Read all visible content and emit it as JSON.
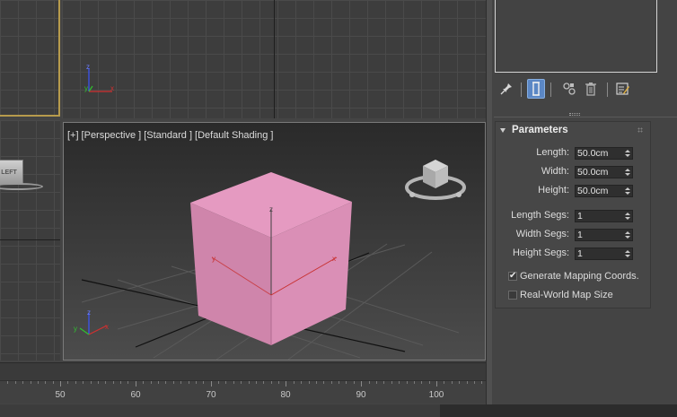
{
  "viewports": {
    "top_axis_labels": {
      "y": "y",
      "z": "z",
      "x": "x"
    },
    "left_cube_label": "LEFT",
    "perspective": {
      "label_items": [
        "[+]",
        "[Perspective ]",
        "[Standard ]",
        "[Default Shading ]"
      ],
      "gizmo_axis_labels": {
        "z": "z",
        "y": "y",
        "x": "x"
      },
      "cube_color": "#e08fb8"
    }
  },
  "timeline": {
    "ruler_labels": [
      "50",
      "60",
      "70",
      "80",
      "90",
      "100"
    ]
  },
  "command_panel": {
    "toolbar": {
      "icons": [
        "pin-stack-icon",
        "modifier-stack-icon",
        "make-unique-icon",
        "remove-modifier-icon",
        "configure-modifier-sets-icon"
      ],
      "active_index": 1,
      "accent": "#5b87c5"
    },
    "rollout": {
      "title": "Parameters",
      "fields": [
        {
          "label": "Length:",
          "value": "50.0cm"
        },
        {
          "label": "Width:",
          "value": "50.0cm"
        },
        {
          "label": "Height:",
          "value": "50.0cm"
        },
        {
          "label": "Length Segs:",
          "value": "1"
        },
        {
          "label": "Width Segs:",
          "value": "1"
        },
        {
          "label": "Height Segs:",
          "value": "1"
        }
      ],
      "checkboxes": [
        {
          "label": "Generate Mapping Coords.",
          "checked": true,
          "mark": "✔"
        },
        {
          "label": "Real-World Map Size",
          "checked": false,
          "mark": ""
        }
      ]
    }
  }
}
